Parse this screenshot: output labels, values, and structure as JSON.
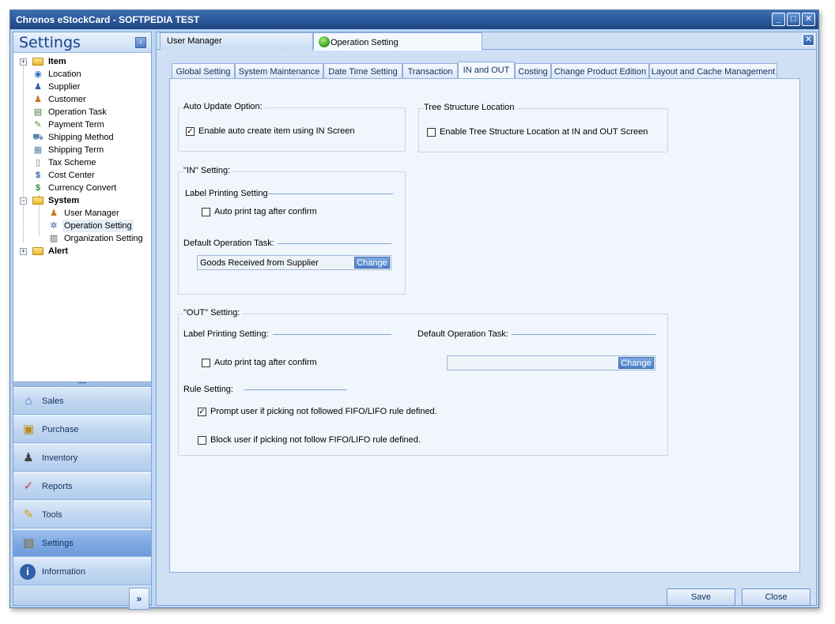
{
  "window": {
    "title": "Chronos eStockCard - SOFTPEDIA TEST"
  },
  "titlebar_buttons": {
    "minimize": "_",
    "maximize": "□",
    "close": "✕"
  },
  "left": {
    "header": "Settings",
    "collapse_glyph": "‹",
    "tree": [
      {
        "label": "Item",
        "bold": true,
        "expander": "+"
      },
      {
        "label": "Location"
      },
      {
        "label": "Supplier"
      },
      {
        "label": "Customer"
      },
      {
        "label": "Operation Task"
      },
      {
        "label": "Payment Term"
      },
      {
        "label": "Shipping Method"
      },
      {
        "label": "Shipping Term"
      },
      {
        "label": "Tax Scheme"
      },
      {
        "label": "Cost Center"
      },
      {
        "label": "Currency Convert"
      },
      {
        "label": "System",
        "bold": true,
        "expander": "−"
      },
      {
        "label": "User Manager"
      },
      {
        "label": "Operation Setting"
      },
      {
        "label": "Organization Setting"
      },
      {
        "label": "Alert",
        "bold": true,
        "expander": "+"
      }
    ],
    "nav": [
      {
        "label": "Sales"
      },
      {
        "label": "Purchase"
      },
      {
        "label": "Inventory"
      },
      {
        "label": "Reports"
      },
      {
        "label": "Tools"
      },
      {
        "label": "Settings"
      },
      {
        "label": "Information"
      }
    ],
    "more_glyph": "»"
  },
  "doc_tabs": [
    {
      "label": "User Manager"
    },
    {
      "label": "Operation Setting"
    }
  ],
  "settings_tabs": [
    {
      "label": "Global Setting"
    },
    {
      "label": "System Maintenance"
    },
    {
      "label": "Date Time Setting"
    },
    {
      "label": "Transaction"
    },
    {
      "label": "IN and OUT"
    },
    {
      "label": "Costing"
    },
    {
      "label": "Change Product Edition"
    },
    {
      "label": "Layout and Cache Management"
    }
  ],
  "auto_update": {
    "title": "Auto Update Option:",
    "enable_label": "Enable auto create item using IN Screen",
    "enable_checked": true
  },
  "tree_structure": {
    "title": "Tree Structure Location",
    "enable_label": "Enable Tree Structure Location at IN and OUT Screen",
    "enable_checked": false
  },
  "in_setting": {
    "title": "\"IN\" Setting:",
    "label_printing": "Label Printing Setting",
    "auto_print_label": "Auto print tag after confirm",
    "auto_print_checked": false,
    "default_task_label": "Default Operation Task:",
    "default_task_value": "Goods Received from Supplier",
    "change_label": "Change"
  },
  "out_setting": {
    "title": "\"OUT\" Setting:",
    "label_printing": "Label Printing Setting:",
    "auto_print_label": "Auto print tag after confirm",
    "auto_print_checked": false,
    "default_task_label": "Default Operation Task:",
    "default_task_value": "",
    "change_label": "Change",
    "rule_setting": "Rule Setting:",
    "prompt_label": "Prompt user if picking not followed FIFO/LIFO rule defined.",
    "prompt_checked": true,
    "block_label": "Block user if picking not follow FIFO/LIFO rule defined.",
    "block_checked": false
  },
  "footer": {
    "save": "Save",
    "close": "Close"
  },
  "check_glyph": "✓"
}
